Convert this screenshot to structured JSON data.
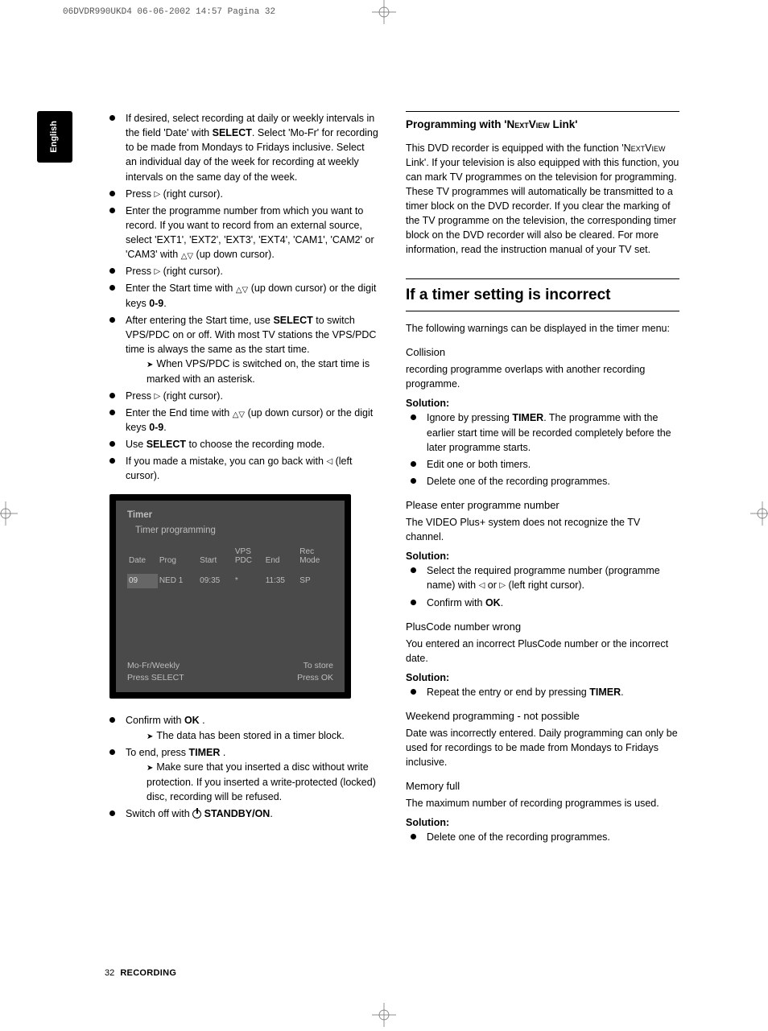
{
  "print_header": "06DVDR990UKD4  06-06-2002  14:57  Pagina 32",
  "lang_tab": "English",
  "footer": {
    "page": "32",
    "section": "RECORDING"
  },
  "left": {
    "items": [
      {
        "pre": "If desired, select recording at daily or weekly intervals in the field '",
        "ui1": "Date",
        "mid1": "' with ",
        "b1": "SELECT",
        "mid2": ". Select '",
        "ui2": "Mo-Fr",
        "post": "' for recording to be made from Mondays to Fridays inclusive. Select an individual day of the week for recording at weekly intervals on the same day of the week."
      },
      {
        "pre": "Press ",
        "tri_r": true,
        "post": " (right cursor)."
      },
      {
        "pre": "Enter the programme number from which you want to record. If you want to record from an external source, select '",
        "ui_list": [
          "EXT1",
          "EXT2",
          "EXT3",
          "EXT4",
          "CAM1",
          "CAM2",
          "CAM3"
        ],
        "sep": "', '",
        "last_sep": "' or '",
        "mid": "' with ",
        "updn": true,
        "post": " (up down cursor)."
      },
      {
        "pre": "Press ",
        "tri_r": true,
        "post": " (right cursor)."
      },
      {
        "pre": "Enter the Start time with ",
        "updn": true,
        "mid": " (up down cursor) or the digit keys ",
        "b1": "0-9",
        "post": "."
      },
      {
        "pre": "After entering the Start time, use ",
        "b1": "SELECT",
        "post": " to switch VPS/PDC on or off. With most TV stations the VPS/PDC time is always the same as the start time.",
        "arrow": "When VPS/PDC is switched on, the start time is marked with an asterisk."
      },
      {
        "pre": "Press ",
        "tri_r": true,
        "post": " (right cursor)."
      },
      {
        "pre": "Enter the End time with ",
        "updn": true,
        "mid": " (up down cursor) or the digit keys ",
        "b1": "0-9",
        "post": "."
      },
      {
        "pre": "Use ",
        "b1": "SELECT",
        "post": " to choose the recording mode."
      },
      {
        "pre": "If you made a mistake, you can go back with ",
        "tri_l": true,
        "post": " (left cursor)."
      }
    ],
    "after_osd": [
      {
        "pre": "Confirm with ",
        "b1": "OK",
        "post": " .",
        "arrow": "The data has been stored in a timer block."
      },
      {
        "pre": "To end, press ",
        "b1": "TIMER",
        "post": " .",
        "arrow": "Make sure that you inserted a disc without write protection. If you inserted a write-protected (locked) disc, recording will be refused."
      },
      {
        "pre": "Switch off with ",
        "power": true,
        "b1": " STANDBY/ON",
        "post": "."
      }
    ]
  },
  "osd": {
    "title": "Timer",
    "subtitle": "Timer programming",
    "headers": [
      "Date",
      "Prog",
      "Start",
      "VPS\nPDC",
      "End",
      "Rec\nMode"
    ],
    "row": [
      "09",
      "NED 1",
      "09:35",
      "*",
      "11:35",
      "SP"
    ],
    "footer_left_1": "Mo-Fr/Weekly",
    "footer_left_2": "Press SELECT",
    "footer_right_1": "To store",
    "footer_right_2": "Press OK"
  },
  "right": {
    "h_prog": {
      "pre": "Programming with '",
      "sc": "NextView",
      "post": " Link'"
    },
    "prog_para": {
      "p1": "This DVD recorder is equipped with the function '",
      "sc": "NextView",
      "p2": " Link'. If your television is also equipped with this function, you can mark TV programmes on the television for programming. These TV programmes will automatically be transmitted to a timer block on the DVD recorder. If you clear the marking of the TV programme on the television, the corresponding timer block on the DVD recorder will also be cleared. For more information, read the instruction manual of your TV set."
    },
    "h_incorrect": "If a timer setting is incorrect",
    "incorrect_intro": "The following warnings can be displayed in the timer menu:",
    "warns": [
      {
        "title": "Collision",
        "desc": "recording programme overlaps with another recording programme.",
        "solution_label": "Solution:",
        "bullets": [
          {
            "pre": "Ignore by pressing ",
            "b1": "TIMER",
            "post": ". The programme with the earlier start time will be recorded completely before the later programme starts."
          },
          {
            "pre": "Edit one or both timers."
          },
          {
            "pre": "Delete one of the recording programmes."
          }
        ]
      },
      {
        "title": "Please enter programme number",
        "desc": "The VIDEO Plus+ system does not recognize the TV channel.",
        "solution_label": "Solution:",
        "bullets": [
          {
            "pre": "Select the required programme number (programme name) with ",
            "tri_l": true,
            "mid": " or ",
            "tri_r": true,
            "post": "  (left right cursor)."
          },
          {
            "pre": "Confirm with ",
            "b1": "OK",
            "post": "."
          }
        ]
      },
      {
        "title": "PlusCode number wrong",
        "desc": "You entered an incorrect PlusCode number or the incorrect date.",
        "solution_label": "Solution:",
        "bullets": [
          {
            "pre": "Repeat the entry or end by pressing ",
            "b1": "TIMER",
            "post": "."
          }
        ]
      },
      {
        "title": "Weekend programming - not possible",
        "desc": "Date was incorrectly entered. Daily programming can only be used for recordings to be made from Mondays to Fridays inclusive."
      },
      {
        "title": "Memory full",
        "desc": "The maximum number of recording programmes is used.",
        "solution_label": "Solution:",
        "bullets": [
          {
            "pre": "Delete one of the recording programmes."
          }
        ]
      }
    ]
  }
}
